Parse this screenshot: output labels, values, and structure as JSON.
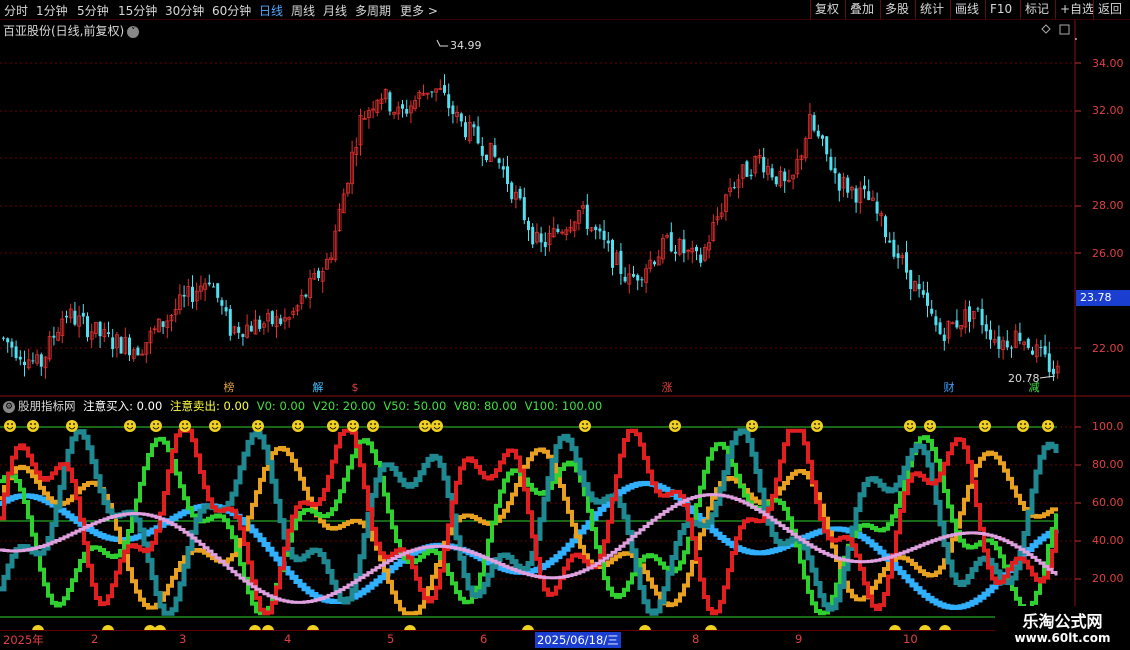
{
  "periods": [
    "分时",
    "1分钟",
    "5分钟",
    "15分钟",
    "30分钟",
    "60分钟",
    "日线",
    "周线",
    "月线",
    "多周期",
    "更多 >"
  ],
  "active_period": "日线",
  "right_buttons": [
    "复权",
    "叠加",
    "多股",
    "统计",
    "画线",
    "F10",
    "标记",
    "+自选",
    "返回"
  ],
  "chart_title": "百亚股份(日线,前复权)",
  "high_marker": "34.99",
  "low_marker": "20.78",
  "current_price": "23.78",
  "price_ticks": [
    "34.00",
    "32.00",
    "30.00",
    "28.00",
    "26.00",
    "22.00"
  ],
  "indicator": {
    "name": "股朋指标网",
    "buy_label": "注意买入: 0.00",
    "sell_label": "注意卖出: 0.00",
    "v0": "V0: 0.00",
    "v20": "V20: 20.00",
    "v50": "V50: 50.00",
    "v80": "V80: 80.00",
    "v100": "V100: 100.00",
    "ticks": [
      "100.0",
      "80.00",
      "60.00",
      "40.00",
      "20.00"
    ]
  },
  "events": [
    {
      "label": "榜",
      "color": "#e0a040"
    },
    {
      "label": "解",
      "color": "#40c0ff"
    },
    {
      "label": "$",
      "color": "#e04040"
    },
    {
      "label": "涨",
      "color": "#e04040"
    },
    {
      "label": "财",
      "color": "#40a0ff"
    },
    {
      "label": "减",
      "color": "#40e040"
    }
  ],
  "x_labels": [
    "2025年",
    "2",
    "3",
    "4",
    "5",
    "6",
    "2025/06/18/三",
    "8",
    "9",
    "10"
  ],
  "watermark": {
    "line1": "乐淘公式网",
    "line2": "www.60lt.com"
  },
  "colors": {
    "up": "#e03030",
    "down": "#50e0f0",
    "grid": "#6a0000"
  }
}
